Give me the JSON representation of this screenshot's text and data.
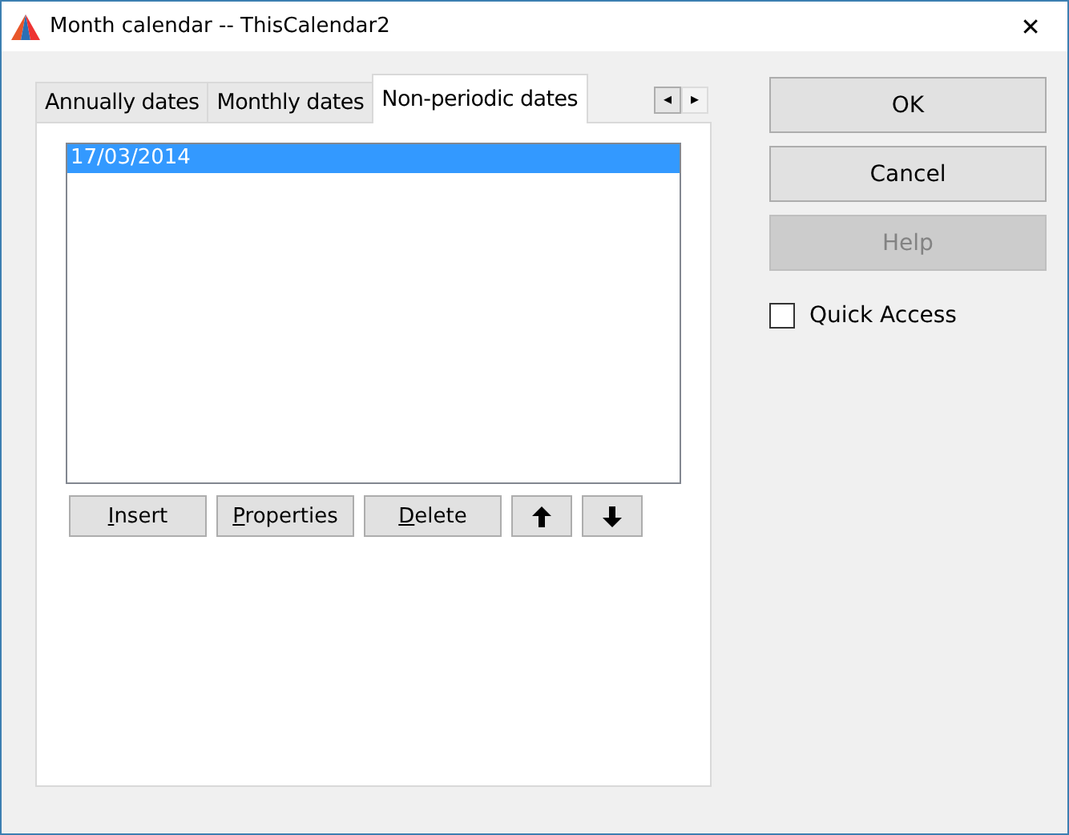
{
  "window": {
    "title": "Month calendar -- ThisCalendar2",
    "close": "✕"
  },
  "tabs": [
    {
      "label": "Annually dates",
      "selected": false
    },
    {
      "label": "Monthly dates",
      "selected": false
    },
    {
      "label": "Non-periodic dates",
      "selected": true
    }
  ],
  "tab_scroll": [
    "◂",
    "▸"
  ],
  "list": {
    "items": [
      {
        "text": "17/03/2014",
        "selected": true
      }
    ]
  },
  "list_buttons": [
    {
      "kind": "text",
      "accel": "I",
      "rest": "nsert"
    },
    {
      "kind": "text",
      "accel": "P",
      "rest": "roperties"
    },
    {
      "kind": "text",
      "accel": "D",
      "rest": "elete"
    },
    {
      "kind": "up"
    },
    {
      "kind": "down"
    }
  ],
  "buttons": [
    {
      "label": "OK",
      "disabled": false
    },
    {
      "label": "Cancel",
      "disabled": false
    },
    {
      "label": "Help",
      "disabled": true
    }
  ],
  "quick_access": {
    "label": "Quick Access",
    "checked": false
  }
}
